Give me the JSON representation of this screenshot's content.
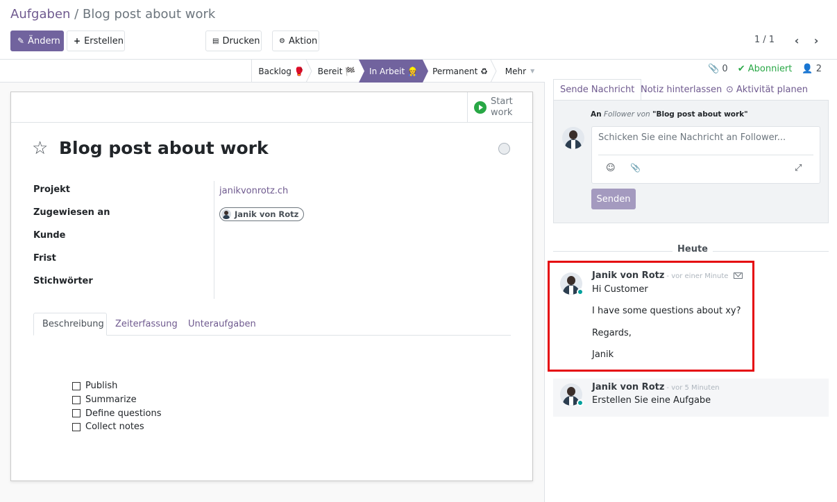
{
  "breadcrumb": {
    "parent": "Aufgaben",
    "separator": "/",
    "current": "Blog post about work"
  },
  "toolbar": {
    "edit_label": "Ändern",
    "create_label": "Erstellen",
    "print_label": "Drucken",
    "action_label": "Aktion"
  },
  "pager": {
    "value": "1 / 1"
  },
  "stages": [
    {
      "label": "Backlog 🥊"
    },
    {
      "label": "Bereit 🏁"
    },
    {
      "label": "In Arbeit 👷"
    },
    {
      "label": "Permanent ♻"
    },
    {
      "label": "Mehr"
    }
  ],
  "active_stage": "In Arbeit",
  "button_box": {
    "start_work_line1": "Start",
    "start_work_line2": "work"
  },
  "task": {
    "title": "Blog post about work",
    "fields": {
      "project_label": "Projekt",
      "project_value": "janikvonrotz.ch",
      "assigned_label": "Zugewiesen an",
      "assigned_value": "Janik von Rotz",
      "customer_label": "Kunde",
      "deadline_label": "Frist",
      "tags_label": "Stichwörter"
    },
    "tabs": [
      "Beschreibung",
      "Zeiterfassung",
      "Unteraufgaben"
    ],
    "checklist": [
      "Publish",
      "Summarize",
      "Define questions",
      "Collect notes"
    ]
  },
  "chatter": {
    "attachments_count": "0",
    "followed_label": "Abonniert",
    "followers_count": "2",
    "tabs": [
      "Sende Nachricht",
      "Notiz hinterlassen",
      "Aktivität planen"
    ],
    "composer": {
      "to_prefix": "An",
      "to_followers": "Follower von",
      "to_record": "\"Blog post about work\"",
      "placeholder": "Schicken Sie eine Nachricht an Follower...",
      "send_label": "Senden"
    },
    "day_label": "Heute",
    "messages": [
      {
        "author": "Janik von Rotz",
        "date": "- vor einer Minute",
        "lines": [
          "Hi Customer",
          "I have some questions about xy?",
          "Regards,",
          "Janik"
        ]
      },
      {
        "author": "Janik von Rotz",
        "date": "- vor 5 Minuten",
        "lines": [
          "Erstellen Sie eine Aufgabe"
        ]
      }
    ]
  },
  "colors": {
    "brand": "#71639e",
    "link": "#6f5a8f",
    "highlight": "#e5080f",
    "online": "#00a09d"
  }
}
